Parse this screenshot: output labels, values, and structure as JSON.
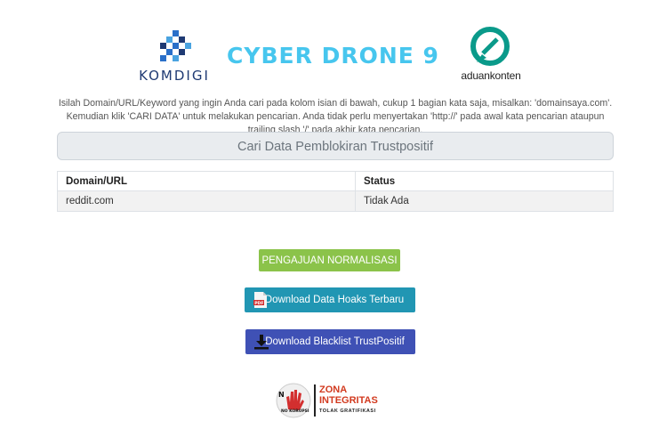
{
  "header": {
    "komdigi_label": "KOMDIGI",
    "cyber_title": "CYBER DRONE 9",
    "aduan_label": "aduankonten"
  },
  "instructions": "Isilah Domain/URL/Keyword yang ingin Anda cari pada kolom isian di bawah, cukup 1 bagian kata saja, misalkan: 'domainsaya.com'. Kemudian klik 'CARI DATA' untuk melakukan pencarian. Anda tidak perlu menyertakan 'http://' pada awal kata pencarian ataupun trailing slash '/' pada akhir kata pencarian.",
  "search": {
    "title": "Cari Data Pemblokiran Trustpositif"
  },
  "results": {
    "columns": [
      "Domain/URL",
      "Status"
    ],
    "rows": [
      [
        "reddit.com",
        "Tidak Ada"
      ]
    ]
  },
  "buttons": {
    "normalisasi": "PENGAJUAN NORMALISASI",
    "hoaks": "Download Data Hoaks Terbaru",
    "blacklist": "Download Blacklist TrustPositif"
  },
  "footer": {
    "nokorupsi_label": "NO KORUPSI",
    "zona_line1": "ZONA",
    "zona_line2": "INTEGRITAS",
    "zona_line3": "TOLAK GRATIFIKASI"
  },
  "colors": {
    "cyber_blue": "#47c6ee",
    "komdigi_navy": "#1f3a73",
    "aduan_green": "#0a9a8a",
    "btn_green": "#8bc34a",
    "btn_teal": "#2196b3",
    "btn_indigo": "#3f51b5",
    "zona_red": "#d23a1f"
  },
  "icons": {
    "hoaks_button": "pdf-file-icon",
    "blacklist_button": "download-icon"
  }
}
